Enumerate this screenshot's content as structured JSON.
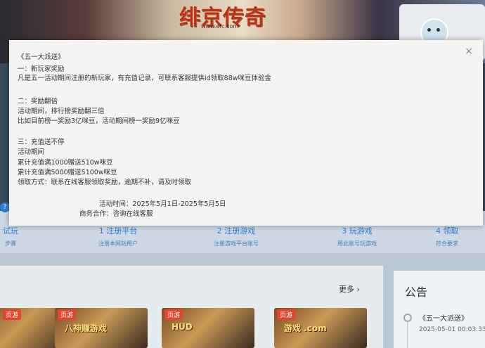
{
  "banner": {
    "title": "绯京传奇",
    "subtitle": "www.efc.com"
  },
  "popup": {
    "heading": "《五一大派送》",
    "section1_title": "一：新玩家奖励",
    "section1_line1": "凡是五一活动期间注册的新玩家，有充值记录，可联系客服提供id领取88w咪豆体验金",
    "section2_title": "二：奖励翻倍",
    "section2_line1": "活动期间，排行榜奖励翻三倍",
    "section2_line2": "比如目前榜一奖励3亿咪豆，活动期间榜一奖励9亿咪豆",
    "section3_title": "三：充值送不停",
    "section3_line1": "活动期间",
    "section3_line2": "累计充值满1000赠送510w咪豆",
    "section3_line3": "累计充值满5000赠送5100w咪豆",
    "section3_line4": "领取方式：联系在线客服领取奖励，逾期不补，请及时领取",
    "activity_time": "活动时间：2025年5月1日-2025年5月5日",
    "business": "商务合作：咨询在线客服",
    "close_icon": "×"
  },
  "steps": [
    {
      "title": "试玩",
      "desc": "步骤"
    },
    {
      "title": "1 注册平台",
      "desc": "注册本网站用户"
    },
    {
      "title": "2 注册游戏",
      "desc": "注册游戏平台账号"
    },
    {
      "title": "3 玩游戏",
      "desc": "用此账号玩游戏"
    },
    {
      "title": "4 领取",
      "desc": "符合要求"
    }
  ],
  "games": {
    "more": "更多 ›",
    "tiles": [
      {
        "tag": "页游",
        "logo": ""
      },
      {
        "tag": "页游",
        "logo": "八神赚游戏"
      },
      {
        "tag": "页游",
        "logo": "HUD"
      },
      {
        "tag": "页游",
        "logo": "游戏 .com"
      }
    ]
  },
  "notice": {
    "title": "公告",
    "item": "《五一大派送》",
    "date": "2025-05-01 00:03:33"
  },
  "colors": {
    "accent": "#2d7fd1",
    "tag": "#e0452f"
  }
}
